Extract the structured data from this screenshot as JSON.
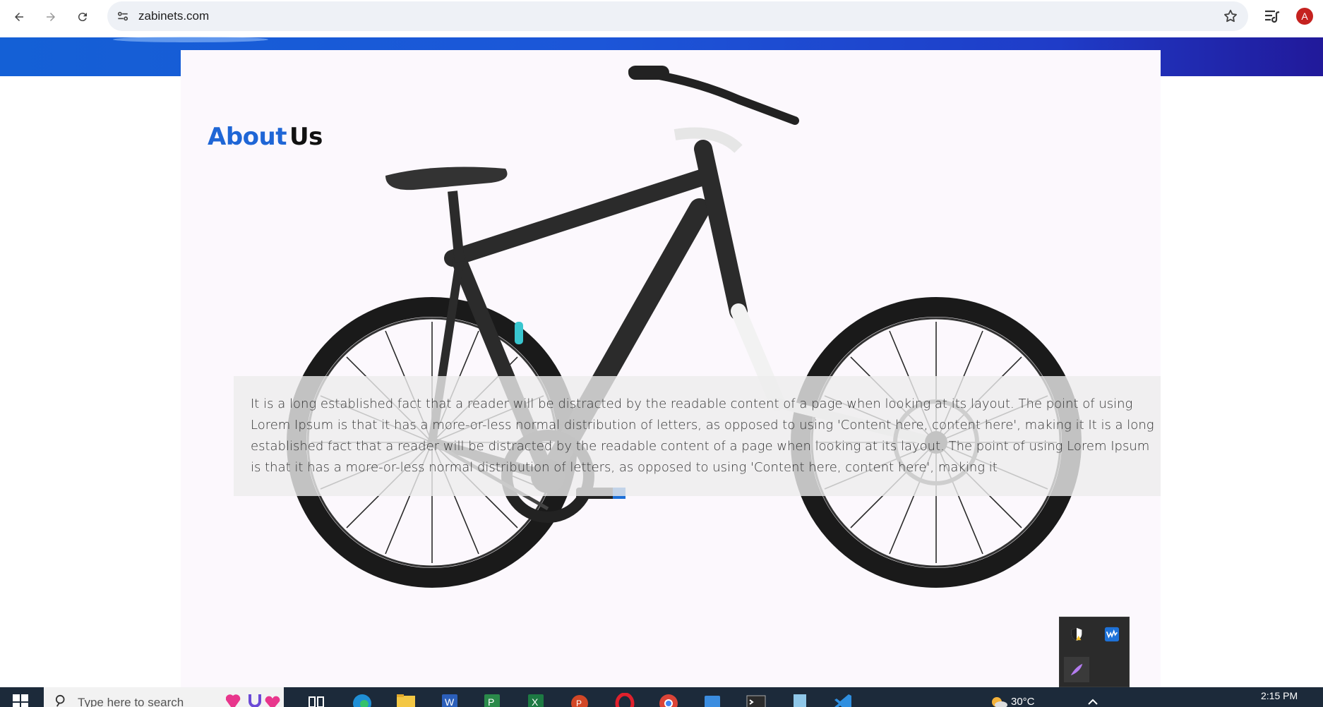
{
  "browser": {
    "url": "zabinets.com",
    "profile_initial": "A"
  },
  "page": {
    "heading_accent": "About",
    "heading_rest": "Us",
    "paragraph": "It is a long established fact that a reader will be distracted by the readable content of a page when looking at its layout. The point of using Lorem Ipsum is that it has a more-or-less normal distribution of letters, as opposed to using 'Content here, content here', making it It is a long established fact that a reader will be distracted by the readable content of a page when looking at its layout. The point of using Lorem Ipsum is that it has a more-or-less normal distribution of letters, as opposed to using 'Content here, content here', making it"
  },
  "taskbar": {
    "search_placeholder": "Type here to search",
    "weather_temp": "30°C",
    "time": "2:15 PM"
  },
  "colors": {
    "banner_start": "#1460d6",
    "banner_end": "#21199a",
    "heading_accent": "#1f66d6"
  },
  "icons": [
    "back-icon",
    "forward-icon",
    "reload-icon",
    "site-info-icon",
    "bookmark-star-icon",
    "tab-search-icon",
    "windows-start-icon",
    "search-icon",
    "security-icon",
    "audio-app-icon",
    "feather-icon"
  ]
}
